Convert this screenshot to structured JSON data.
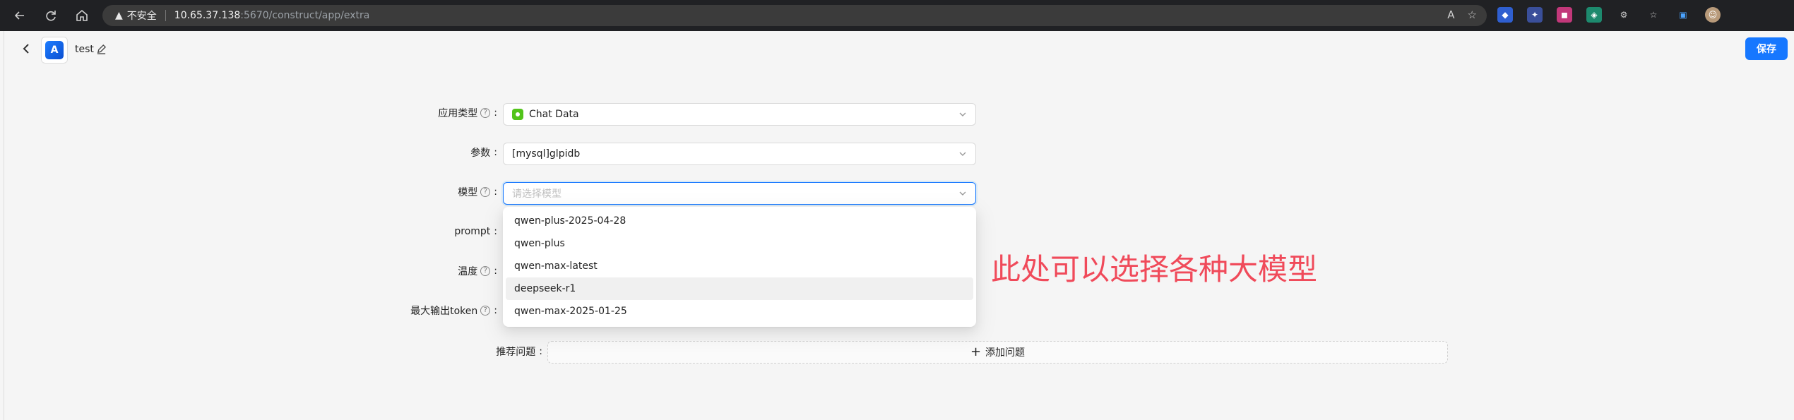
{
  "browser": {
    "security_label": "不安全",
    "url_host": "10.65.37.138",
    "url_path": ":5670/construct/app/extra"
  },
  "header": {
    "app_name": "test",
    "logo_text": "A",
    "save_label": "保存"
  },
  "form": {
    "app_type": {
      "label": "应用类型",
      "value": "Chat Data"
    },
    "params": {
      "label": "参数",
      "value": "[mysql]glpidb"
    },
    "model": {
      "label": "模型",
      "placeholder": "请选择模型"
    },
    "prompt": {
      "label": "prompt"
    },
    "temperature": {
      "label": "温度"
    },
    "max_tokens": {
      "label": "最大输出token"
    },
    "recommended": {
      "label": "推荐问题",
      "add_label": "添加问题"
    }
  },
  "dropdown": {
    "options": [
      "qwen-plus-2025-04-28",
      "qwen-plus",
      "qwen-max-latest",
      "deepseek-r1",
      "qwen-max-2025-01-25"
    ],
    "highlighted": "deepseek-r1"
  },
  "annotation": "此处可以选择各种大模型",
  "colors": {
    "primary": "#1677ff",
    "annotation": "#f04a5a",
    "chrome": "#202124"
  }
}
